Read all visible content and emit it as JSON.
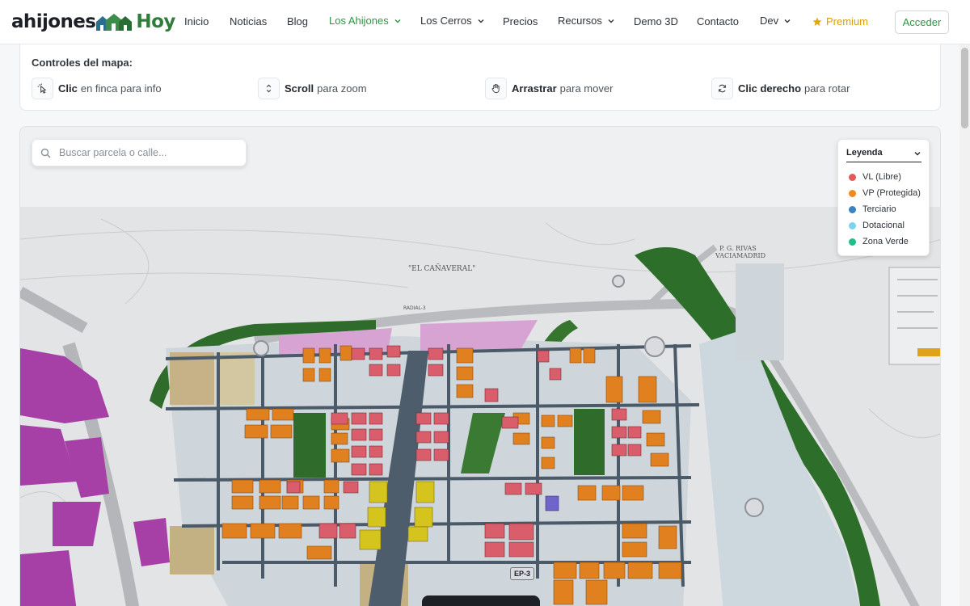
{
  "brand": {
    "part1": "ahijones",
    "part2": "Hoy"
  },
  "nav": {
    "inicio": "Inicio",
    "noticias": "Noticias",
    "blog": "Blog",
    "ahijones": "Los Ahijones",
    "cerros": "Los Cerros",
    "precios": "Precios",
    "recursos": "Recursos",
    "demo": "Demo 3D",
    "contacto": "Contacto",
    "dev": "Dev",
    "premium": "Premium",
    "login": "Acceder"
  },
  "colors": {
    "accent": "#2e9443",
    "premium": "#d8a10a"
  },
  "controls": {
    "title": "Controles del mapa:",
    "items": [
      {
        "icon": "cursor-click-icon",
        "bold": "Clic",
        "text": "en finca para info"
      },
      {
        "icon": "scroll-icon",
        "bold": "Scroll",
        "text": "para zoom"
      },
      {
        "icon": "hand-icon",
        "bold": "Arrastrar",
        "text": "para mover"
      },
      {
        "icon": "rotate-icon",
        "bold": "Clic derecho",
        "text": "para rotar"
      }
    ]
  },
  "map": {
    "search_placeholder": "Buscar parcela o calle...",
    "legend": {
      "title": "Leyenda",
      "items": [
        {
          "label": "VL (Libre)",
          "color": "#e25a5a"
        },
        {
          "label": "VP (Protegida)",
          "color": "#f08a1c"
        },
        {
          "label": "Terciario",
          "color": "#3b82c4"
        },
        {
          "label": "Dotacional",
          "color": "#7dd3ee"
        },
        {
          "label": "Zona Verde",
          "color": "#1fbf8a"
        }
      ]
    },
    "labels": {
      "caneral": "\"EL CAÑAVERAL\"",
      "radial": "RADIAL-3",
      "rivas_1": "P. G. RIVAS",
      "rivas_2": "VACIAMADRID",
      "ep3": "EP-3"
    }
  }
}
